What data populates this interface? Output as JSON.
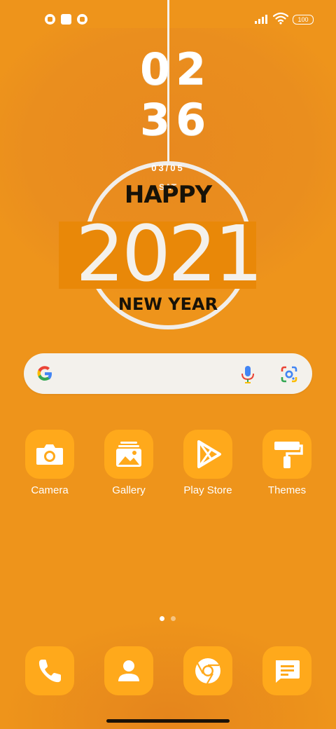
{
  "status_bar": {
    "battery": "100",
    "notification_icons": [
      "app-notification-icon",
      "square-notification-icon",
      "app-notification-icon"
    ]
  },
  "clock": {
    "hours": "02",
    "minutes": "36",
    "date": "03/05",
    "day": "SAT"
  },
  "wallpaper": {
    "line1": "HAPPY",
    "year": "2021",
    "line3": "NEW YEAR"
  },
  "search": {
    "icons": [
      "google-g-icon",
      "microphone-icon",
      "google-lens-icon"
    ]
  },
  "apps": [
    {
      "label": "Camera",
      "icon": "camera-icon"
    },
    {
      "label": "Gallery",
      "icon": "gallery-icon"
    },
    {
      "label": "Play Store",
      "icon": "play-store-icon"
    },
    {
      "label": "Themes",
      "icon": "themes-paint-roller-icon"
    }
  ],
  "dock": [
    {
      "icon": "phone-icon"
    },
    {
      "icon": "contacts-icon"
    },
    {
      "icon": "chrome-icon"
    },
    {
      "icon": "messages-icon"
    }
  ],
  "page_indicator": {
    "pages": 2,
    "current": 1
  },
  "colors": {
    "background": "#EE941B",
    "tile": "#FFA91B",
    "text": "#FFFFFF",
    "dark_text": "#171208",
    "search_bg": "#F3F1EC"
  }
}
